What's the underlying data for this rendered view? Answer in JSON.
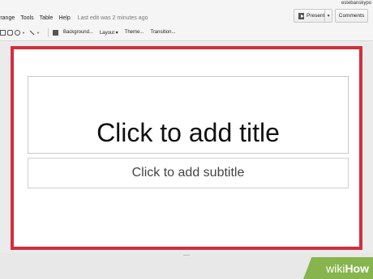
{
  "user": {
    "email": "estebanskypo"
  },
  "menu": {
    "items": [
      "rrange",
      "Tools",
      "Table",
      "Help"
    ],
    "last_edit": "Last edit was 2 minutes ago"
  },
  "buttons": {
    "present": "Present",
    "comments": "Comments"
  },
  "toolbar": {
    "background": "Background...",
    "layout": "Layout",
    "theme": "Theme...",
    "transition": "Transition..."
  },
  "slide": {
    "title_placeholder": "Click to add title",
    "subtitle_placeholder": "Click to add subtitle",
    "border_color": "#d22e3e"
  },
  "watermark": {
    "wiki": "wiki",
    "how": "How"
  }
}
